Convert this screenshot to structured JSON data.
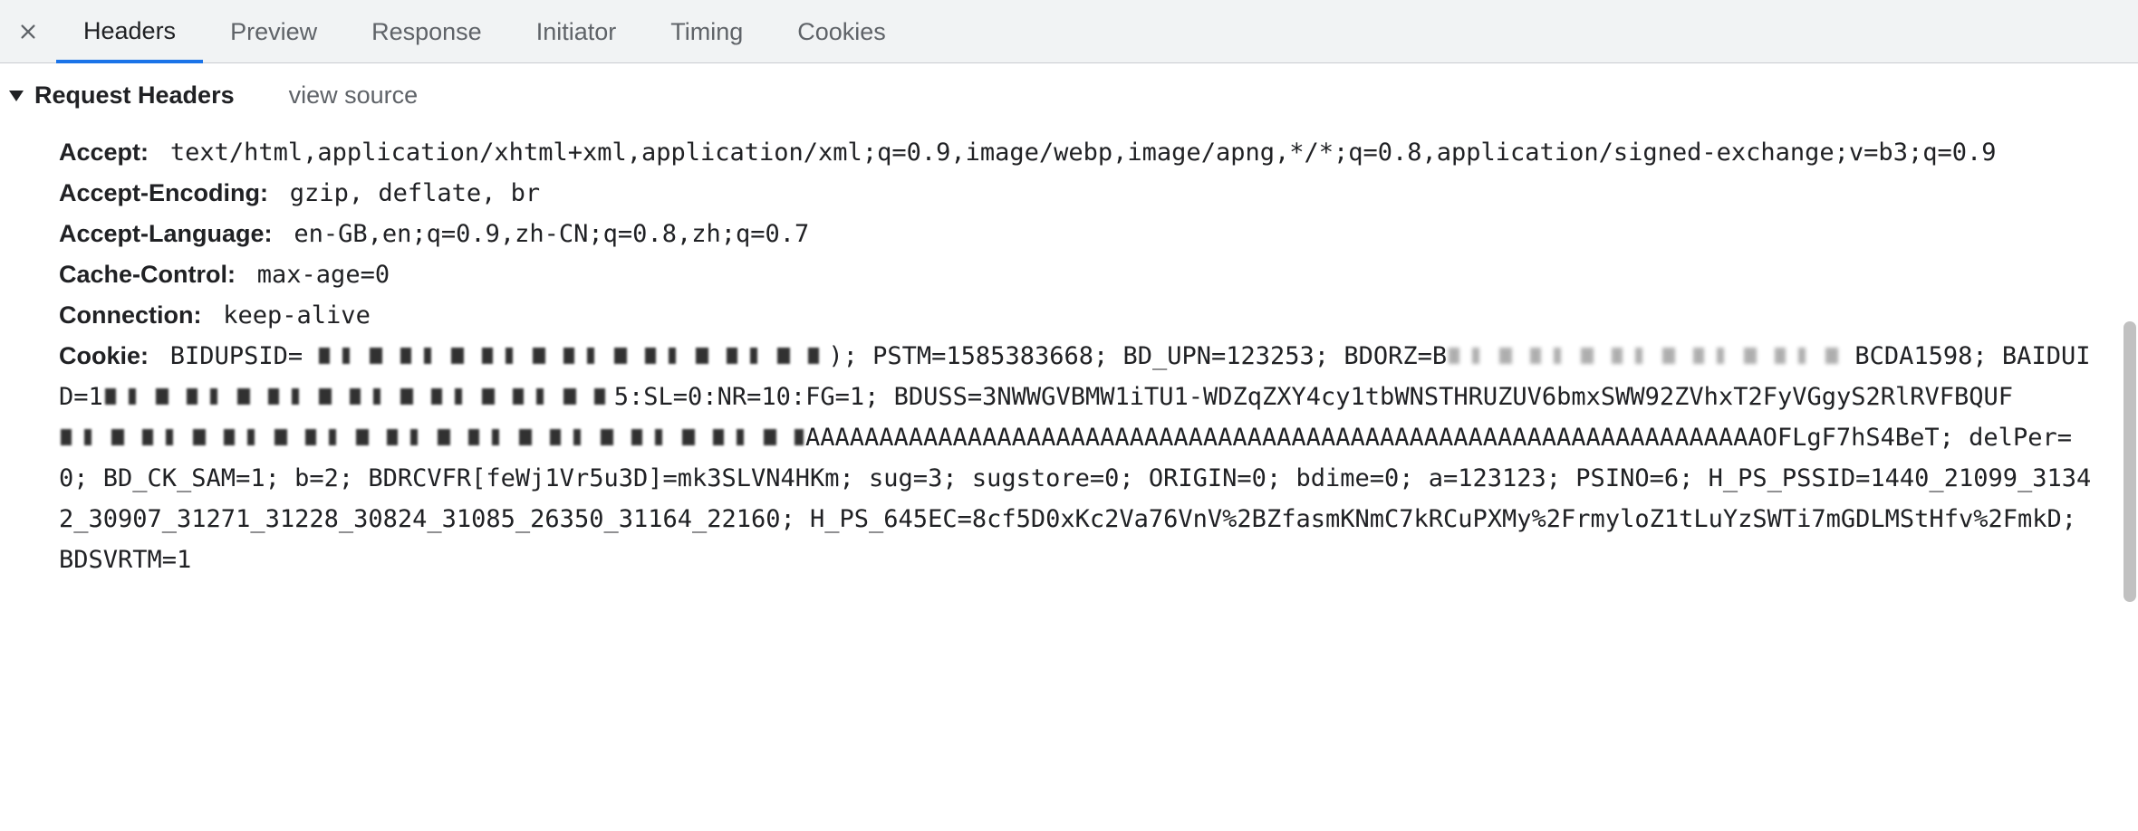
{
  "tabs": {
    "headers": "Headers",
    "preview": "Preview",
    "response": "Response",
    "initiator": "Initiator",
    "timing": "Timing",
    "cookies": "Cookies"
  },
  "section": {
    "title": "Request Headers",
    "view_source": "view source"
  },
  "headers": {
    "accept": {
      "name": "Accept:",
      "value": "text/html,application/xhtml+xml,application/xml;q=0.9,image/webp,image/apng,*/*;q=0.8,application/signed-exchange;v=b3;q=0.9"
    },
    "accept_encoding": {
      "name": "Accept-Encoding:",
      "value": "gzip, deflate, br"
    },
    "accept_language": {
      "name": "Accept-Language:",
      "value": "en-GB,en;q=0.9,zh-CN;q=0.8,zh;q=0.7"
    },
    "cache_control": {
      "name": "Cache-Control:",
      "value": "max-age=0"
    },
    "connection": {
      "name": "Connection:",
      "value": "keep-alive"
    },
    "cookie": {
      "name": "Cookie:",
      "segments": {
        "s1": "BIDUPSID=",
        "s1_tail": "); PSTM=1585383668; BD_UPN=123253; BDORZ=B",
        "s1_end": "BCDA1598; BAIDUID=1",
        "s2_tail": "5:SL=0:NR=10:FG=1; BDUSS=3NWWGVBMW1iTU1-WDZqZXY4cy1tbWNSTHRUZUV6bmxSWW92ZVhxT2FyVGgyS2RlRVFBQUF",
        "s3_tail": "AAAAAAAAAAAAAAAAAAAAAAAAAAAAAAAAAAAAAAAAAAAAAAAAAAAAAAAAAAAAAAAAAOFLgF7hS4BeT; delPer=0; BD_CK_SAM=1; b=2; BDRCVFR[feWj1Vr5u3D]=mk3SLVN4HKm; sug=3; sugstore=0; ORIGIN=0; bdime=0; a=123123; PSINO=6; H_PS_PSSID=1440_21099_31342_30907_31271_31228_30824_31085_26350_31164_22160; H_PS_645EC=8cf5D0xKc2Va76VnV%2BZfasmKNmC7kRCuPXMy%2FrmyloZ1tLuYzSWTi7mGDLMStHfv%2FmkD; BDSVRTM=1"
      }
    }
  }
}
